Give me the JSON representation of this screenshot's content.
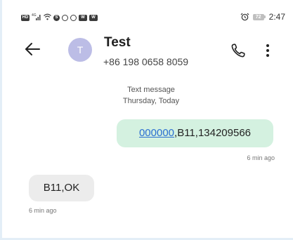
{
  "status_bar": {
    "left_icons": [
      "hd-badge",
      "signal-icon",
      "wifi-icon",
      "app-s-icon",
      "whatsapp-icon",
      "location-icon",
      "app-w-icon",
      "app-w2-icon"
    ],
    "hd_label": "HD",
    "signal_label": "4G",
    "app_s_label": "S",
    "app_w_label": "W",
    "battery_level": "72",
    "time": "2:47"
  },
  "header": {
    "avatar_initial": "T",
    "contact_name": "Test",
    "contact_number": "+86 198 0658 8059",
    "icons": {
      "back": "back-arrow-icon",
      "call": "phone-icon",
      "more": "more-vertical-icon"
    }
  },
  "conversation": {
    "channel": "Text message",
    "date": "Thursday, Today"
  },
  "messages": [
    {
      "direction": "outgoing",
      "link_text": "000000",
      "rest_text": ",B11,134209566",
      "time": "6 min ago",
      "bubble_color": "#d4f1e0"
    },
    {
      "direction": "incoming",
      "text": "B11,OK",
      "time": "6 min ago",
      "bubble_color": "#ececec"
    }
  ],
  "colors": {
    "avatar": "#bcbde6",
    "link": "#2b6fd1"
  }
}
